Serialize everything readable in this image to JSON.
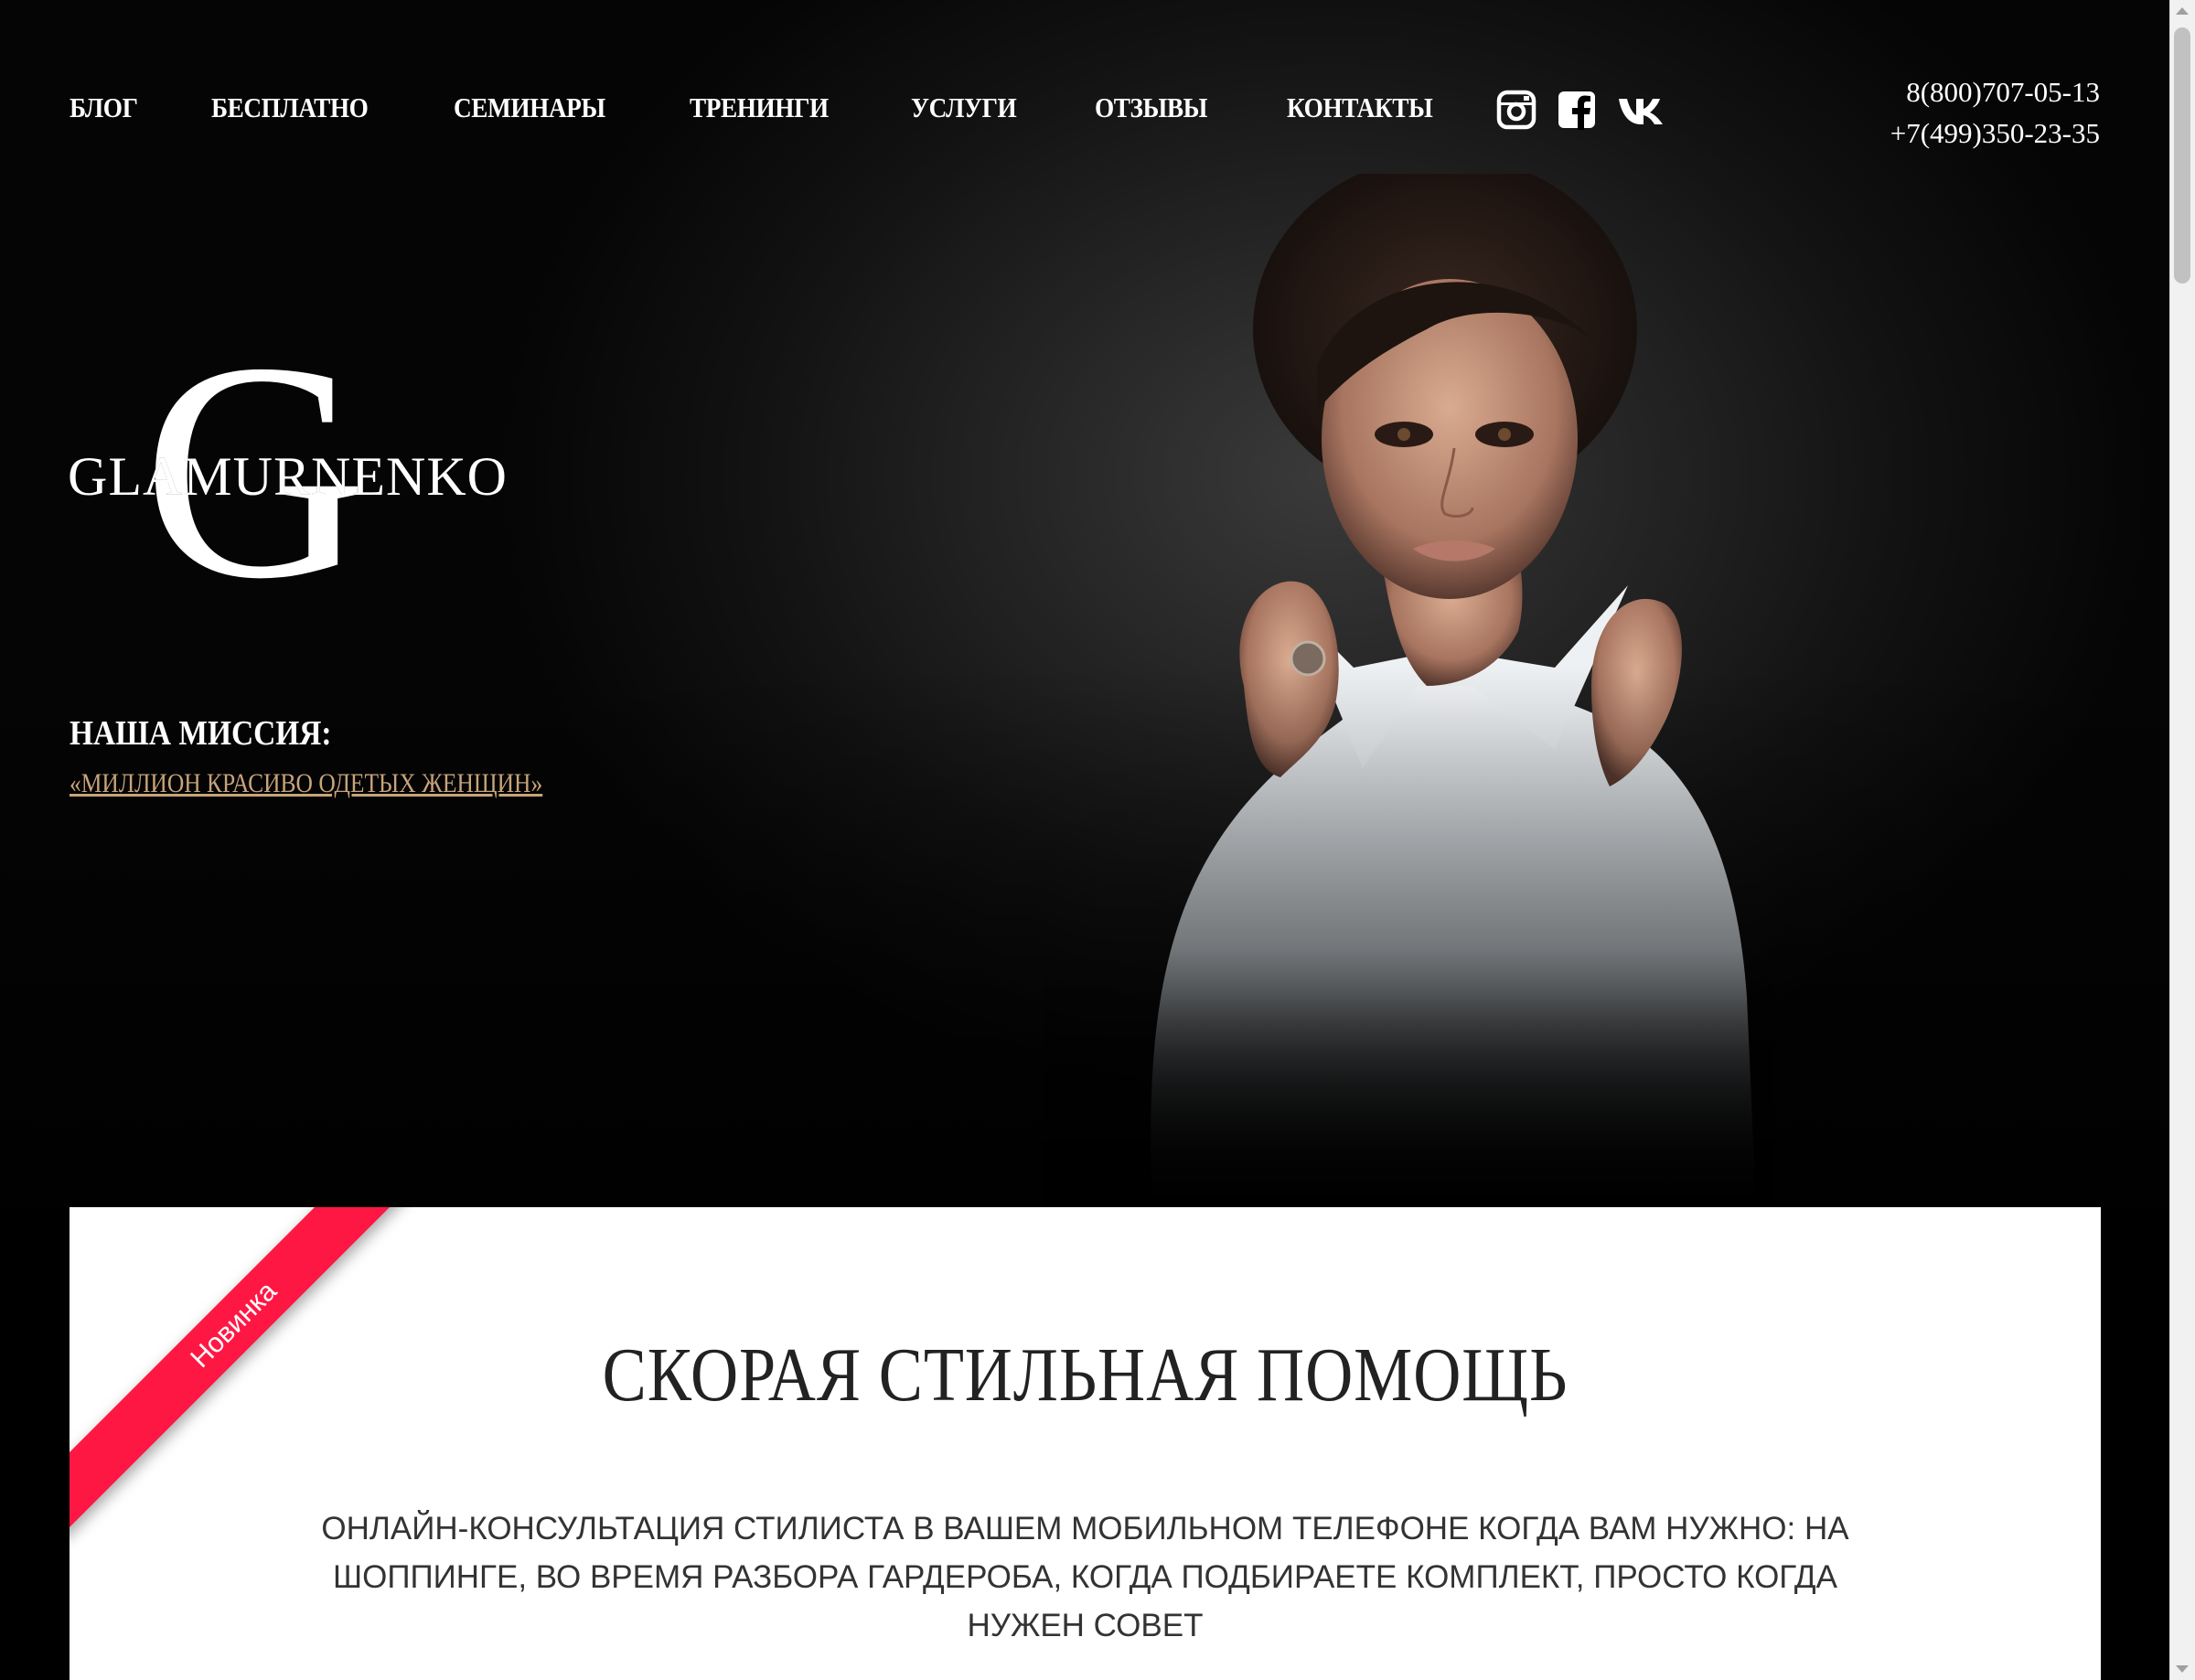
{
  "nav": {
    "items": [
      {
        "label": "БЛОГ"
      },
      {
        "label": "БЕСПЛАТНО"
      },
      {
        "label": "СЕМИНАРЫ"
      },
      {
        "label": "ТРЕНИНГИ"
      },
      {
        "label": "УСЛУГИ"
      },
      {
        "label": "ОТЗЫВЫ"
      },
      {
        "label": "КОНТАКТЫ"
      }
    ]
  },
  "social": {
    "icons": [
      "instagram-icon",
      "facebook-icon",
      "vk-icon"
    ]
  },
  "phones": {
    "phone1": "8(800)707-05-13",
    "phone2": "+7(499)350-23-35"
  },
  "logo": {
    "letter": "G",
    "word": "GLAMURNENKO"
  },
  "mission": {
    "title": "НАША МИССИЯ:",
    "link_text": "«МИЛЛИОН КРАСИВО ОДЕТЫХ ЖЕНЩИН»"
  },
  "card": {
    "ribbon": "Новинка",
    "title": "СКОРАЯ СТИЛЬНАЯ ПОМОЩЬ",
    "text": "ОНЛАЙН-КОНСУЛЬТАЦИЯ СТИЛИСТА В ВАШЕМ МОБИЛЬНОМ ТЕЛЕФОНЕ КОГДА ВАМ НУЖНО: НА ШОППИНГЕ, ВО ВРЕМЯ РАЗБОРА ГАРДЕРОБА, КОГДА ПОДБИРАЕТЕ КОМПЛЕКТ, ПРОСТО КОГДА НУЖЕН СОВЕТ"
  },
  "colors": {
    "accent_link": "#c7a47a",
    "ribbon": "#ff1744",
    "background": "#000000"
  }
}
